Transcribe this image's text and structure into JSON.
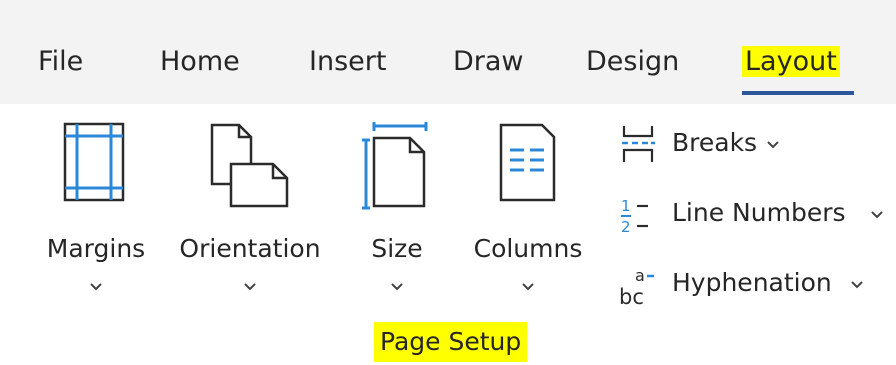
{
  "tabs": [
    {
      "label": "File"
    },
    {
      "label": "Home"
    },
    {
      "label": "Insert"
    },
    {
      "label": "Draw"
    },
    {
      "label": "Design"
    },
    {
      "label": "Layout",
      "active": true
    }
  ],
  "ribbon": {
    "margins": {
      "label": "Margins",
      "icon": "margins-icon"
    },
    "orientation": {
      "label": "Orientation",
      "icon": "orientation-icon"
    },
    "size": {
      "label": "Size",
      "icon": "page-size-icon"
    },
    "columns": {
      "label": "Columns",
      "icon": "columns-icon"
    },
    "breaks": {
      "label": "Breaks",
      "icon": "breaks-icon"
    },
    "line_numbers": {
      "label": "Line Numbers",
      "icon": "line-numbers-icon"
    },
    "hyphenation": {
      "label": "Hyphenation",
      "icon": "hyphenation-icon"
    },
    "group_label": "Page Setup"
  },
  "colors": {
    "tabbar_bg": "#f3f3f3",
    "highlight": "#ffff00",
    "accent_blue": "#2b88d8",
    "underline": "#2b579a"
  }
}
